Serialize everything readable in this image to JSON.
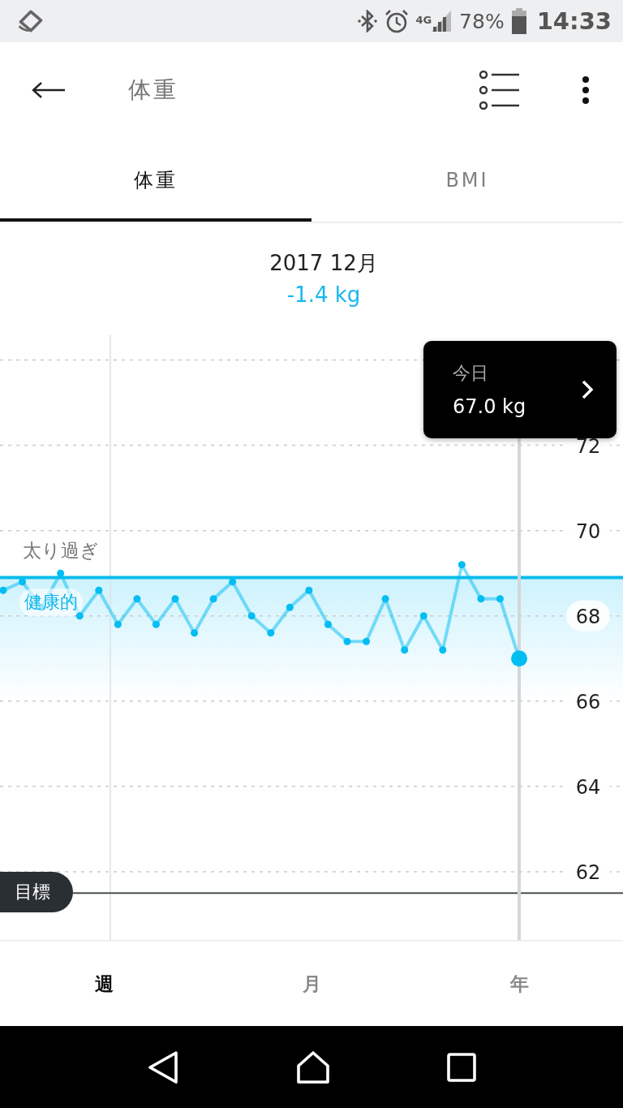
{
  "status_bar": {
    "network": "4G",
    "battery": "78%",
    "time": "14:33"
  },
  "header": {
    "title": "体重"
  },
  "tabs": [
    {
      "label": "体重",
      "selected": true
    },
    {
      "label": "BMI",
      "selected": false
    }
  ],
  "summary": {
    "period": "2017 12月",
    "change": "-1.4 kg"
  },
  "chart": {
    "tooltip": {
      "label": "今日",
      "value": "67.0 kg"
    },
    "chart_data": {
      "type": "line",
      "ylim": [
        60.4,
        74.6
      ],
      "grid": true,
      "yticks": [
        62,
        64,
        66,
        68,
        70,
        72
      ],
      "categories": [
        null,
        null,
        null,
        null,
        null,
        null,
        null,
        null,
        null,
        null,
        null,
        null,
        null,
        null,
        null,
        null,
        null,
        null,
        null,
        null,
        null,
        null,
        null,
        null,
        null,
        null,
        null,
        null
      ],
      "series": [
        {
          "color": "#00bdf2",
          "marker": "circle",
          "values": [
            68.6,
            68.8,
            68.2,
            69.0,
            68.0,
            68.6,
            67.8,
            68.4,
            67.8,
            68.4,
            67.6,
            68.4,
            68.8,
            68.0,
            67.6,
            68.2,
            68.6,
            67.8,
            67.4,
            67.4,
            68.4,
            67.2,
            68.0,
            67.2,
            69.2,
            68.4,
            68.4,
            67.0
          ]
        }
      ],
      "bands": [
        {
          "axis": "y",
          "from": 66.0,
          "to": 68.9,
          "label": "健康的"
        }
      ],
      "ref_lines": [
        {
          "axis": "y",
          "value": 68.9,
          "label": "太り過ぎ"
        },
        {
          "axis": "y",
          "value": 61.5,
          "label": "目標"
        }
      ]
    }
  },
  "range_tabs": [
    {
      "label": "週",
      "selected": true
    },
    {
      "label": "月",
      "selected": false
    },
    {
      "label": "年",
      "selected": false
    }
  ]
}
